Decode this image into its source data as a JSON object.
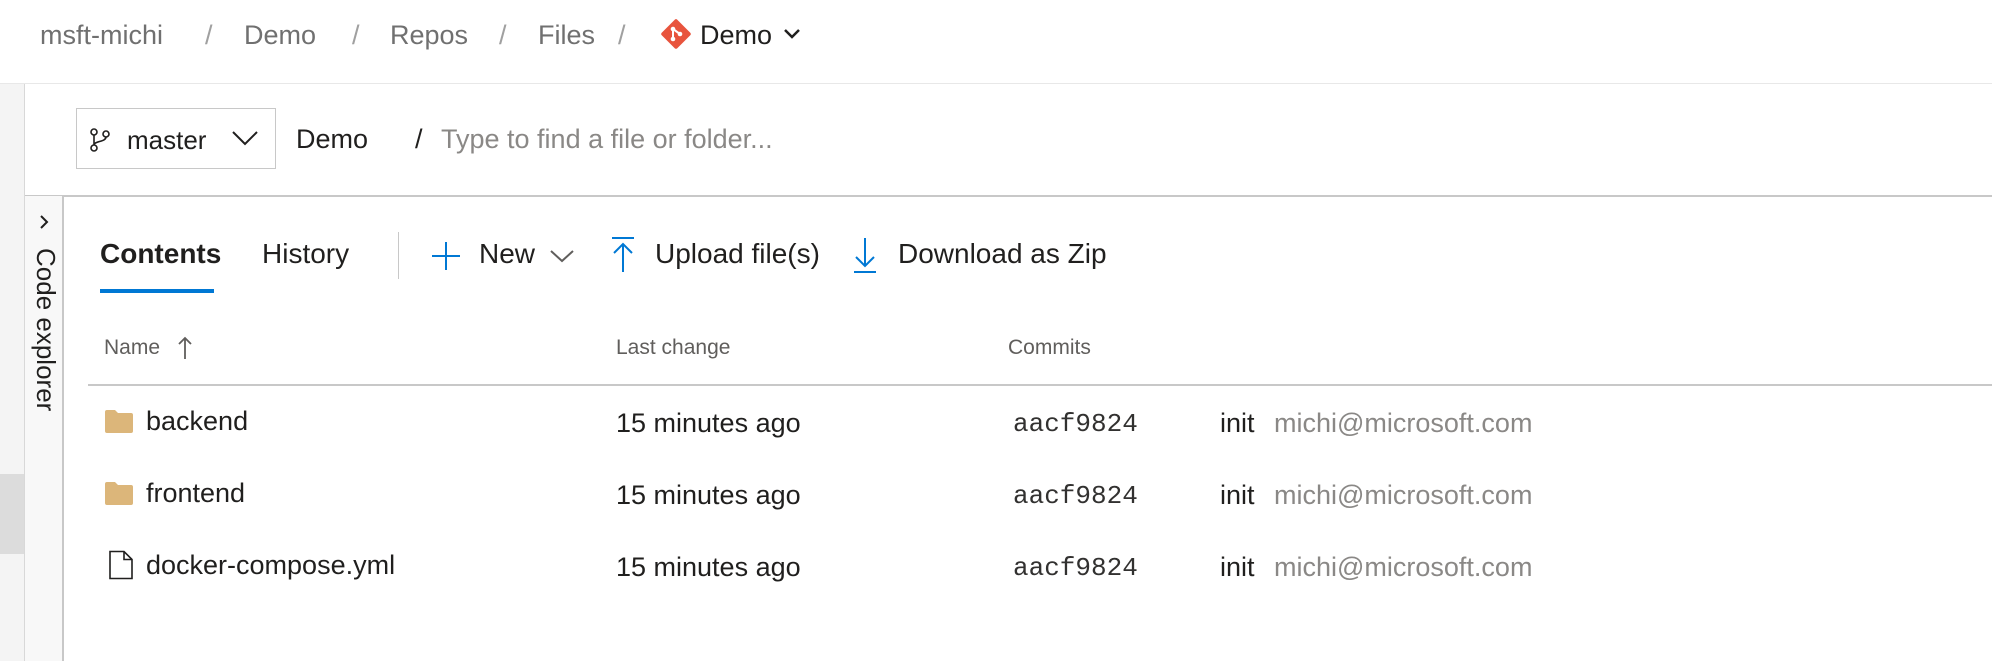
{
  "breadcrumb": {
    "org": "msft-michi",
    "project": "Demo",
    "section": "Repos",
    "page": "Files",
    "repo": "Demo",
    "separator": "/"
  },
  "pathbar": {
    "branch": "master",
    "root": "Demo",
    "separator": "/",
    "search_placeholder": "Type to find a file or folder..."
  },
  "explorer": {
    "label": "Code explorer"
  },
  "toolbar": {
    "tabs": [
      {
        "label": "Contents",
        "selected": true
      },
      {
        "label": "History",
        "selected": false
      }
    ],
    "new_label": "New",
    "upload_label": "Upload file(s)",
    "download_label": "Download as Zip"
  },
  "table": {
    "columns": {
      "name": "Name",
      "last_change": "Last change",
      "commits": "Commits"
    },
    "rows": [
      {
        "type": "folder",
        "name": "backend",
        "last_change": "15 minutes ago",
        "commit": "aacf9824",
        "message": "init",
        "author": "michi@microsoft.com"
      },
      {
        "type": "folder",
        "name": "frontend",
        "last_change": "15 minutes ago",
        "commit": "aacf9824",
        "message": "init",
        "author": "michi@microsoft.com"
      },
      {
        "type": "file",
        "name": "docker-compose.yml",
        "last_change": "15 minutes ago",
        "commit": "aacf9824",
        "message": "init",
        "author": "michi@microsoft.com"
      }
    ]
  },
  "colors": {
    "accent": "#0078d4",
    "git_icon": "#e8543d",
    "folder": "#dcb67a"
  },
  "icons": [
    "git-repo-icon",
    "chevron-down-icon",
    "branch-icon",
    "chevron-right-icon",
    "plus-icon",
    "upload-icon",
    "download-icon",
    "sort-arrow-up-icon",
    "folder-icon",
    "file-icon"
  ]
}
